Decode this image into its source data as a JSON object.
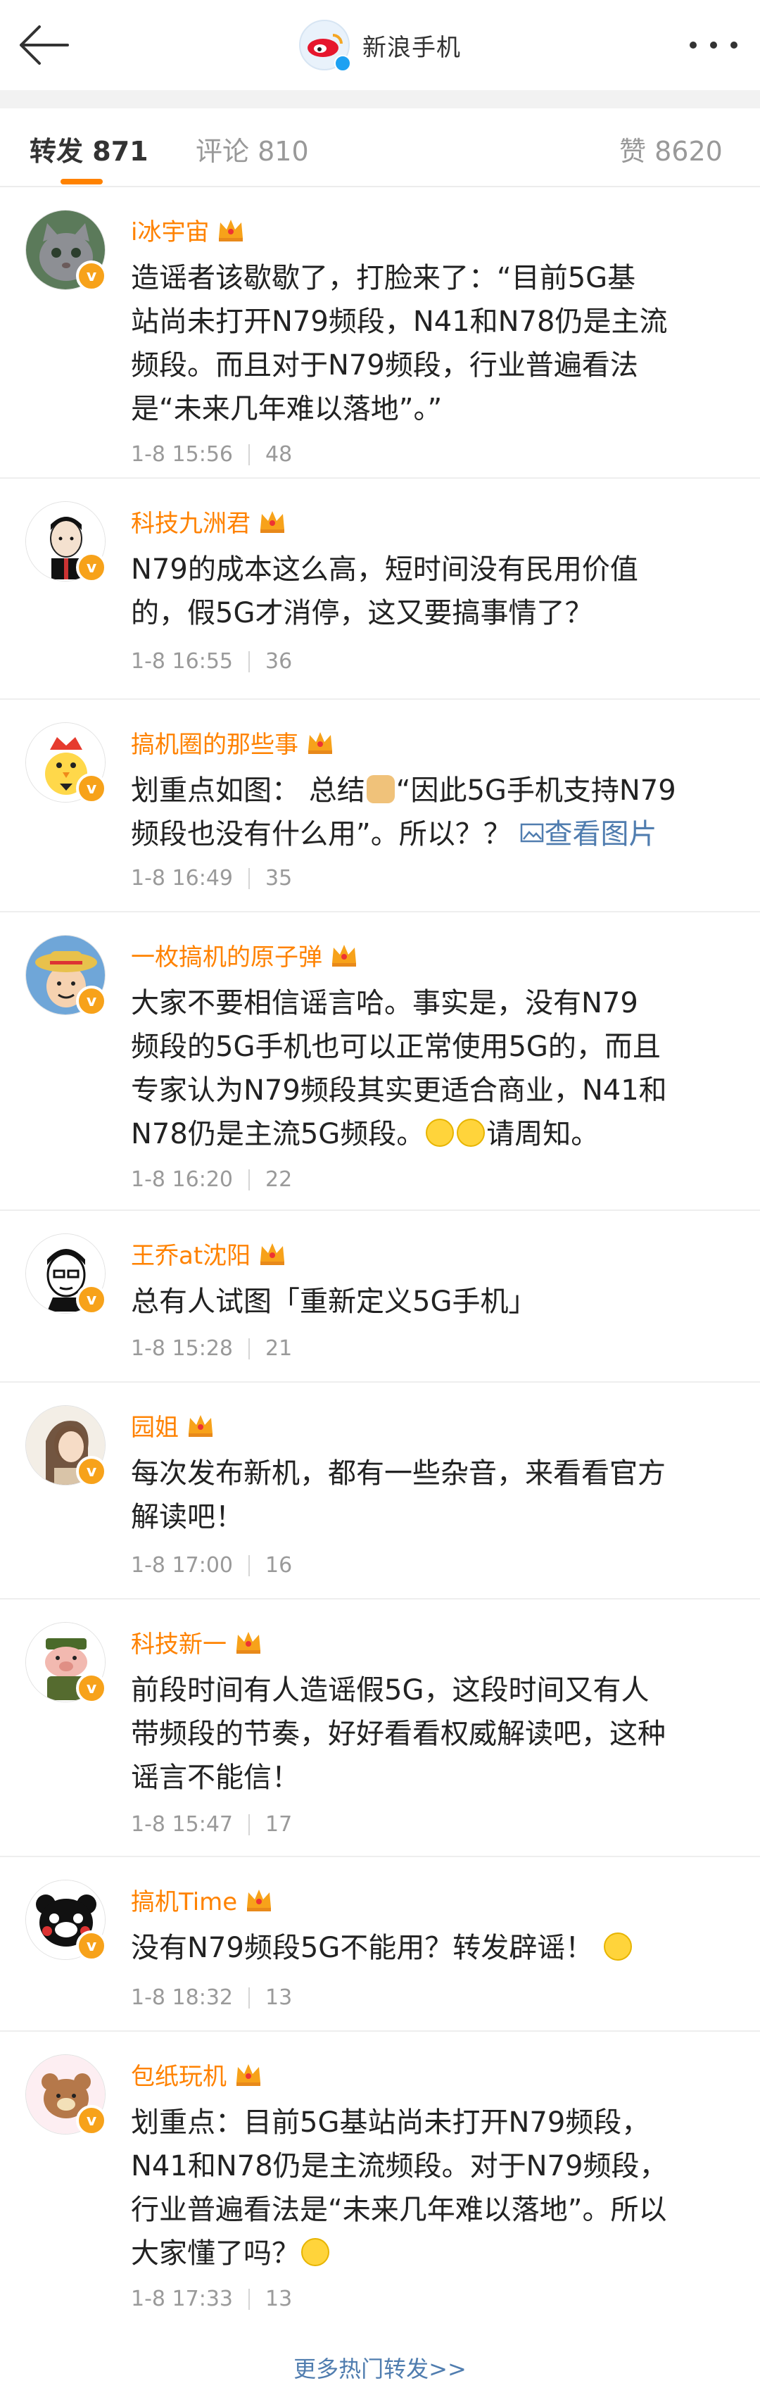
{
  "header": {
    "title": "新浪手机",
    "avatar_text": "sina"
  },
  "tabs": [
    {
      "label": "转发",
      "count": "871"
    },
    {
      "label": "评论",
      "count": "810"
    },
    {
      "label": "赞",
      "count": "8620"
    }
  ],
  "items": [
    {
      "username": "i冰宇宙",
      "lines": [
        "造谣者该歇歇了，打脸来了：“目前5G基",
        "站尚未打开N79频段，N41和N78仍是主流",
        "频段。而且对于N79频段，行业普遍看法",
        "是“未来几年难以落地”。”"
      ],
      "time": "1-8 15:56",
      "likes": "48"
    },
    {
      "username": "科技九洲君",
      "lines": [
        "N79的成本这么高，短时间没有民用价值",
        "的，假5G才消停，这又要搞事情了？"
      ],
      "time": "1-8 16:55",
      "likes": "36"
    },
    {
      "username": "搞机圈的那些事",
      "lines_pre": "划重点如图： 总结",
      "lines_post": "“因此5G手机支持N79",
      "line2": "频段也没有什么用”。所以？？",
      "link": "查看图片",
      "time": "1-8 16:49",
      "likes": "35"
    },
    {
      "username": "一枚搞机的原子弹",
      "lines": [
        "大家不要相信谣言哈。事实是，没有N79",
        "频段的5G手机也可以正常使用5G的，而且",
        "专家认为N79频段其实更适合商业，N41和"
      ],
      "last_pre": "N78仍是主流5G频段。",
      "last_post": "请周知。",
      "time": "1-8 16:20",
      "likes": "22"
    },
    {
      "username": "王乔at沈阳",
      "lines": [
        "总有人试图「重新定义5G手机」"
      ],
      "time": "1-8 15:28",
      "likes": "21"
    },
    {
      "username": "园姐",
      "lines": [
        "每次发布新机，都有一些杂音，来看看官方",
        "解读吧！"
      ],
      "time": "1-8 17:00",
      "likes": "16"
    },
    {
      "username": "科技新一",
      "lines": [
        "前段时间有人造谣假5G，这段时间又有人",
        "带频段的节奏，好好看看权威解读吧，这种",
        "谣言不能信！"
      ],
      "time": "1-8 15:47",
      "likes": "17"
    },
    {
      "username": "搞机Time",
      "text_pre": "没有N79频段5G不能用？转发辟谣！",
      "time": "1-8 18:32",
      "likes": "13"
    },
    {
      "username": "包纸玩机",
      "lines": [
        "划重点：目前5G基站尚未打开N79频段，",
        "N41和N78仍是主流频段。对于N79频段，",
        "行业普遍看法是“未来几年难以落地”。所以"
      ],
      "last_pre": "大家懂了吗？",
      "time": "1-8 17:33",
      "likes": "13"
    }
  ],
  "more_link": "更多热门转发>>",
  "colors": {
    "accent": "#ff8200",
    "link": "#507daf",
    "badge": "#f7a21a"
  }
}
